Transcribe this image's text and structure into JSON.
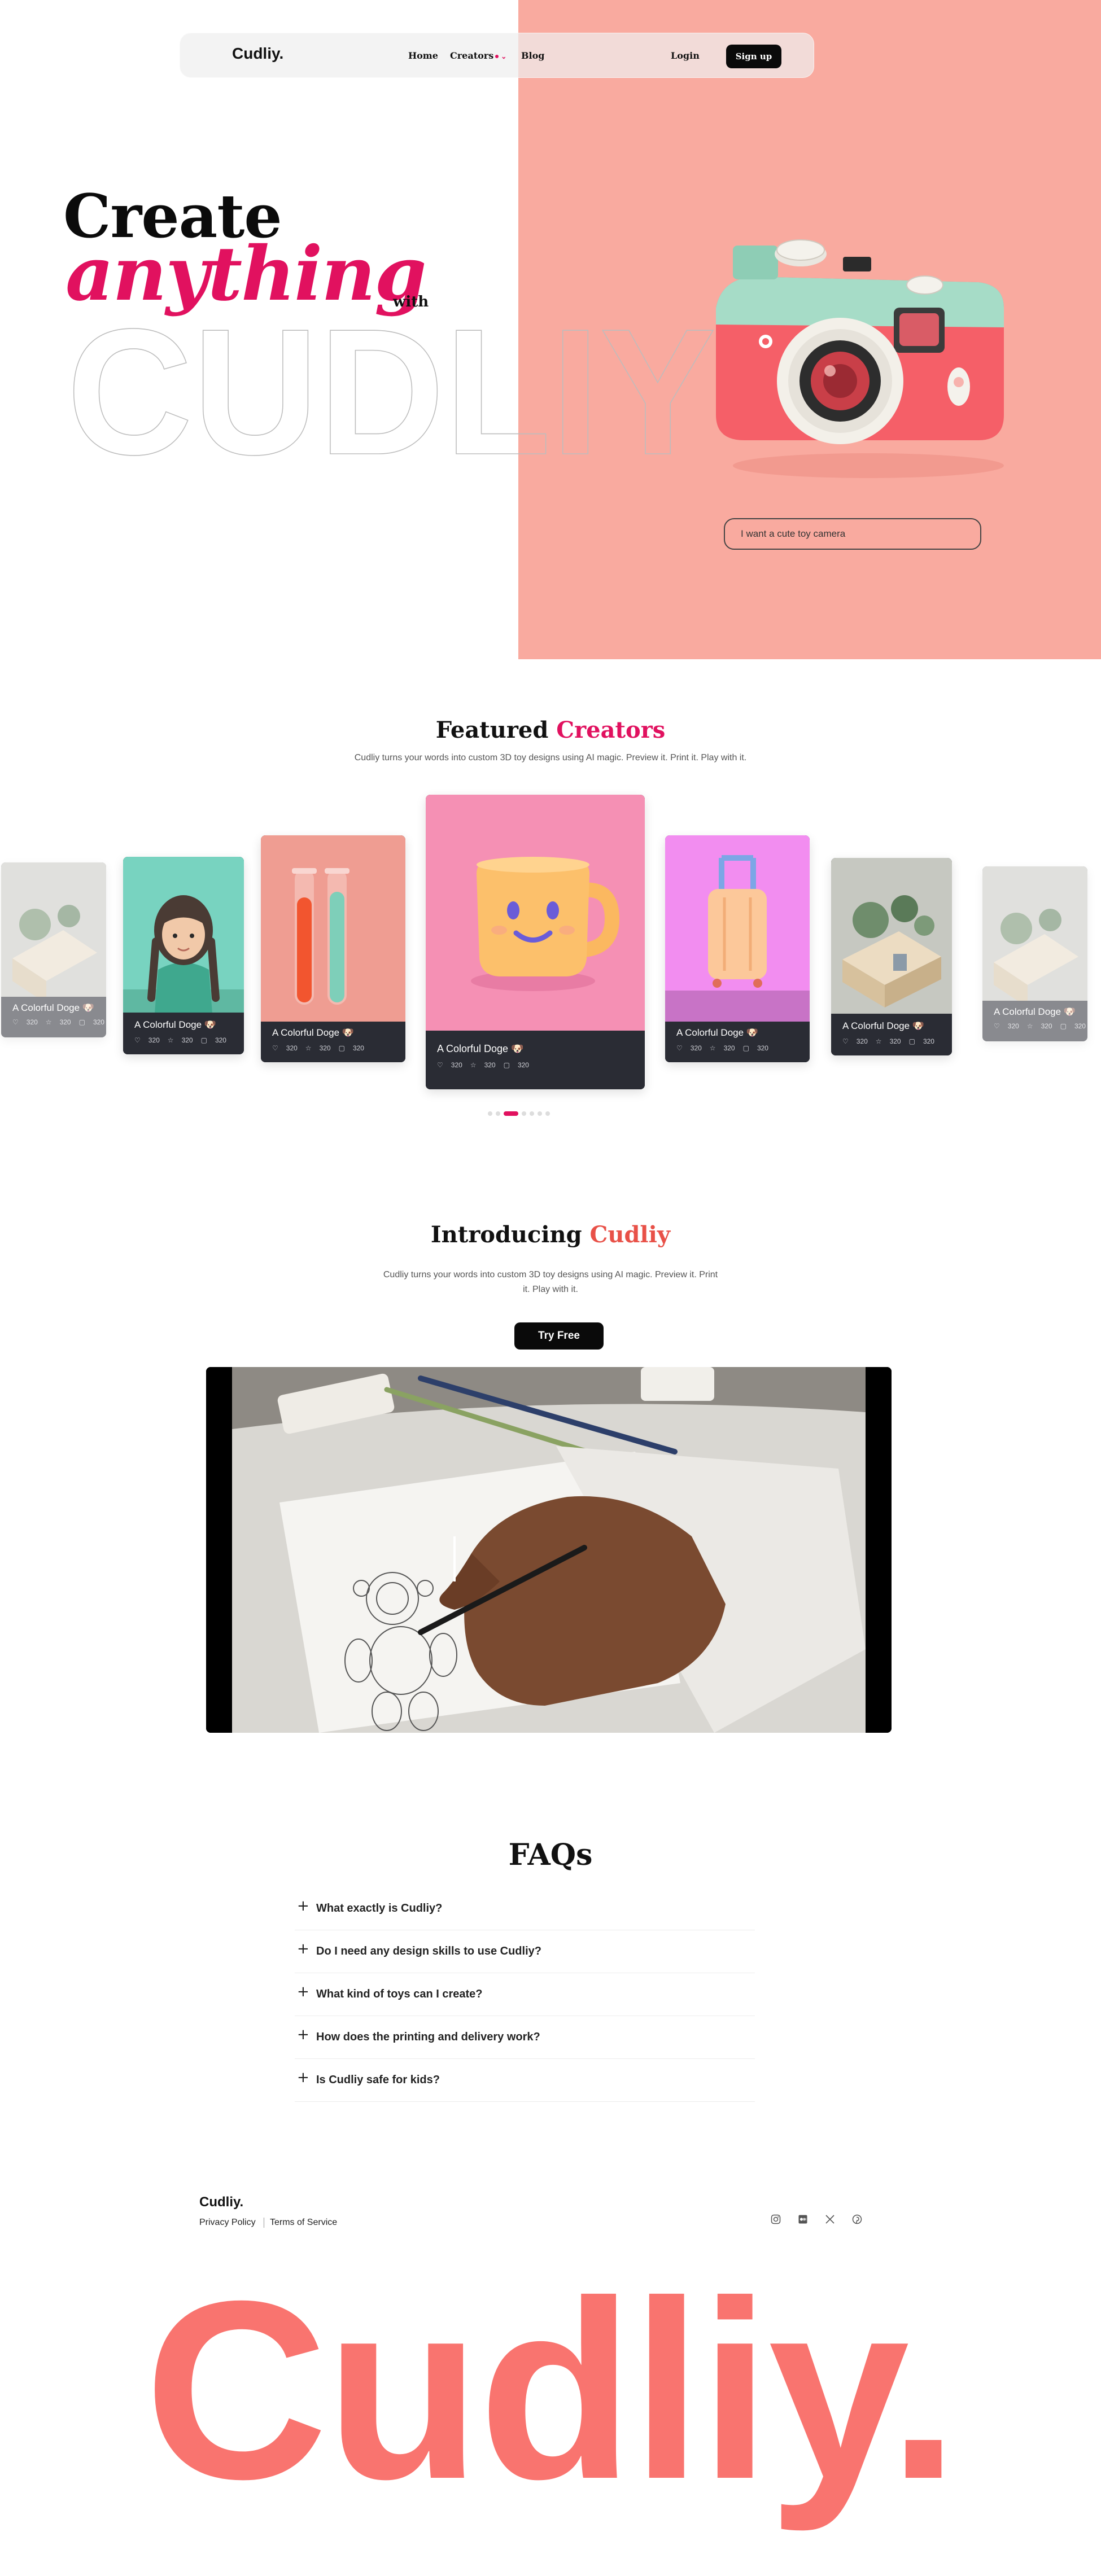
{
  "nav": {
    "logo": "Cudliy.",
    "home": "Home",
    "creators": "Creators",
    "blog": "Blog",
    "login": "Login",
    "signup": "Sign up"
  },
  "hero": {
    "line1": "Create",
    "line2": "anything",
    "with": "with",
    "outline_word": "CUDLIY",
    "input_value": "I want a cute toy camera",
    "bg_color": "#f9aa9f",
    "accent_color": "#e1115f"
  },
  "featured": {
    "title_plain": "Featured",
    "title_accent": "Creators",
    "subtitle": "Cudliy turns your words into custom 3D toy designs using AI magic. Preview it. Print it. Play with it.",
    "cards": [
      {
        "title": "A Colorful Doge 🐶",
        "likes": "320",
        "stars": "320",
        "comments": "320",
        "art": "plant-scene"
      },
      {
        "title": "A Colorful Doge 🐶",
        "likes": "320",
        "stars": "320",
        "comments": "320",
        "art": "girl-figure"
      },
      {
        "title": "A Colorful Doge 🐶",
        "likes": "320",
        "stars": "320",
        "comments": "320",
        "art": "test-tubes"
      },
      {
        "title": "A Colorful Doge 🐶",
        "likes": "320",
        "stars": "320",
        "comments": "320",
        "art": "smiling-mug"
      },
      {
        "title": "A Colorful Doge 🐶",
        "likes": "320",
        "stars": "320",
        "comments": "320",
        "art": "suitcase"
      },
      {
        "title": "A Colorful Doge 🐶",
        "likes": "320",
        "stars": "320",
        "comments": "320",
        "art": "plant-scene"
      },
      {
        "title": "A Colorful Doge 🐶",
        "likes": "320",
        "stars": "320",
        "comments": "320",
        "art": "plant-scene"
      }
    ],
    "active_slide": 2,
    "slide_count": 7
  },
  "intro": {
    "title_plain": "Introducing",
    "title_accent": "Cudliy",
    "subtitle_line1": "Cudliy turns your words into custom 3D toy designs using AI magic. Preview it. Print",
    "subtitle_line2": "it. Play with it.",
    "cta": "Try Free"
  },
  "faq": {
    "title": "FAQs",
    "items": [
      "What exactly is Cudliy?",
      "Do I need any design skills to use Cudliy?",
      "What kind of toys can I create?",
      "How does the printing and delivery work?",
      "Is Cudliy safe for kids?"
    ]
  },
  "footer": {
    "logo": "Cudliy.",
    "privacy": "Privacy Policy",
    "terms": "Terms of Service",
    "social": [
      "instagram-icon",
      "medium-icon",
      "x-icon",
      "pinterest-icon"
    ],
    "big_brand": "Cudliy.",
    "brand_color": "#f9746f"
  }
}
